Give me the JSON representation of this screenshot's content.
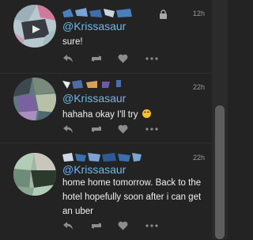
{
  "tweets": [
    {
      "handle": "@Krissasaur",
      "text": "sure!",
      "time": "12h",
      "locked": true,
      "avatar_colors": [
        "#b8c8cf",
        "#d07a9a",
        "#3a3a44",
        "#e8e8e8",
        "#9bb0b7"
      ],
      "name_colors": [
        "#4a7fbf",
        "#7aa4d6",
        "#c8d4e0",
        "#3b6fae"
      ]
    },
    {
      "handle": "@Krissasaur",
      "text": "hahaha okay I'll try",
      "emoji": "grinning-sweat-emoji",
      "time": "22h",
      "locked": false,
      "avatar_colors": [
        "#5f7a7c",
        "#7a62a0",
        "#b8c0a8",
        "#3d4850",
        "#a98fbf"
      ],
      "name_colors": [
        "#e8eef4",
        "#4a6fa6",
        "#d6a25a",
        "#6d5aa8"
      ]
    },
    {
      "handle": "@Krissasaur",
      "text": "home home tomorrow. Back to the hotel hopefully soon after i can get an uber",
      "time": "22h",
      "locked": false,
      "avatar_colors": [
        "#9fb8a0",
        "#c9c7bd",
        "#2c3a2e",
        "#6f8b7a",
        "#b2ccb7"
      ],
      "name_colors": [
        "#3b6fae",
        "#7aa4d6",
        "#cfd9e6",
        "#2d5a95"
      ]
    }
  ],
  "icons": {
    "reply": "reply-icon",
    "retweet": "retweet-icon",
    "like": "heart-icon",
    "more": "more-dots-icon",
    "lock": "lock-icon"
  },
  "colors": {
    "background": "#232323",
    "handle": "#6cb9e6",
    "action_icons": "#8d8d8d",
    "scrollbar_thumb": "#5e5e5e"
  }
}
